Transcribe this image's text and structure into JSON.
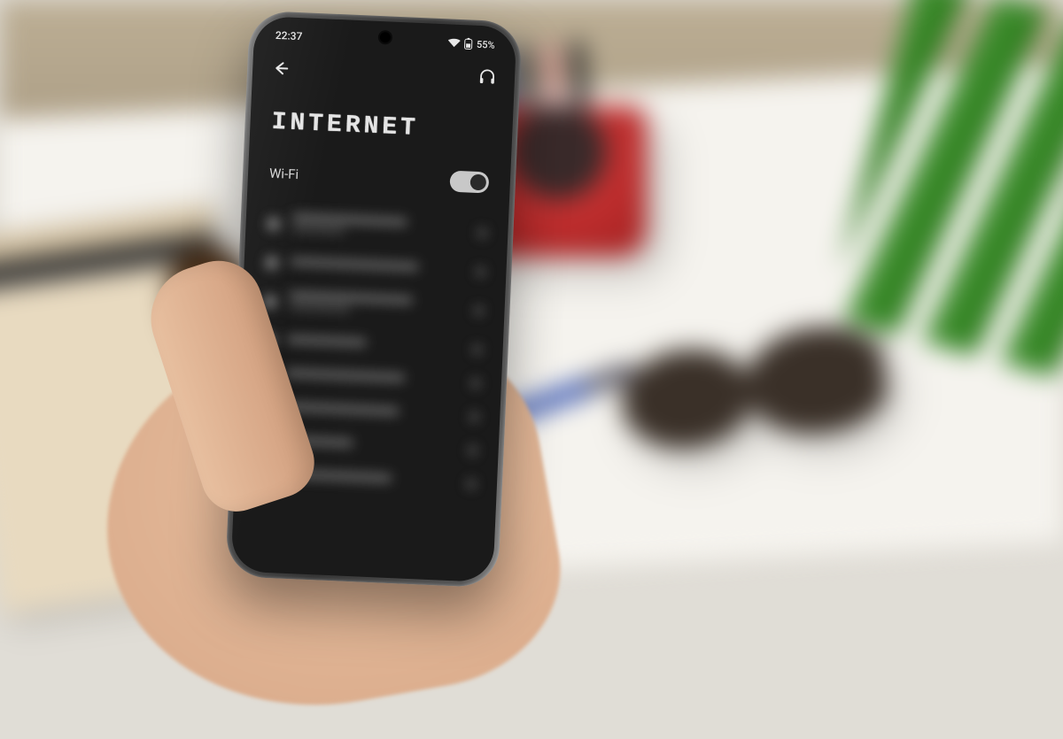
{
  "status": {
    "time": "22:37",
    "battery_pct": "55%"
  },
  "page": {
    "title": "INTERNET",
    "section_label": "Wi-Fi",
    "wifi_on": true
  },
  "networks": [
    {
      "w1": 130,
      "w2": 60
    },
    {
      "w1": 145,
      "w2": 0
    },
    {
      "w1": 140,
      "w2": 70
    },
    {
      "w1": 90,
      "w2": 0
    },
    {
      "w1": 135,
      "w2": 0
    },
    {
      "w1": 130,
      "w2": 0
    },
    {
      "w1": 80,
      "w2": 0
    },
    {
      "w1": 125,
      "w2": 0
    }
  ]
}
